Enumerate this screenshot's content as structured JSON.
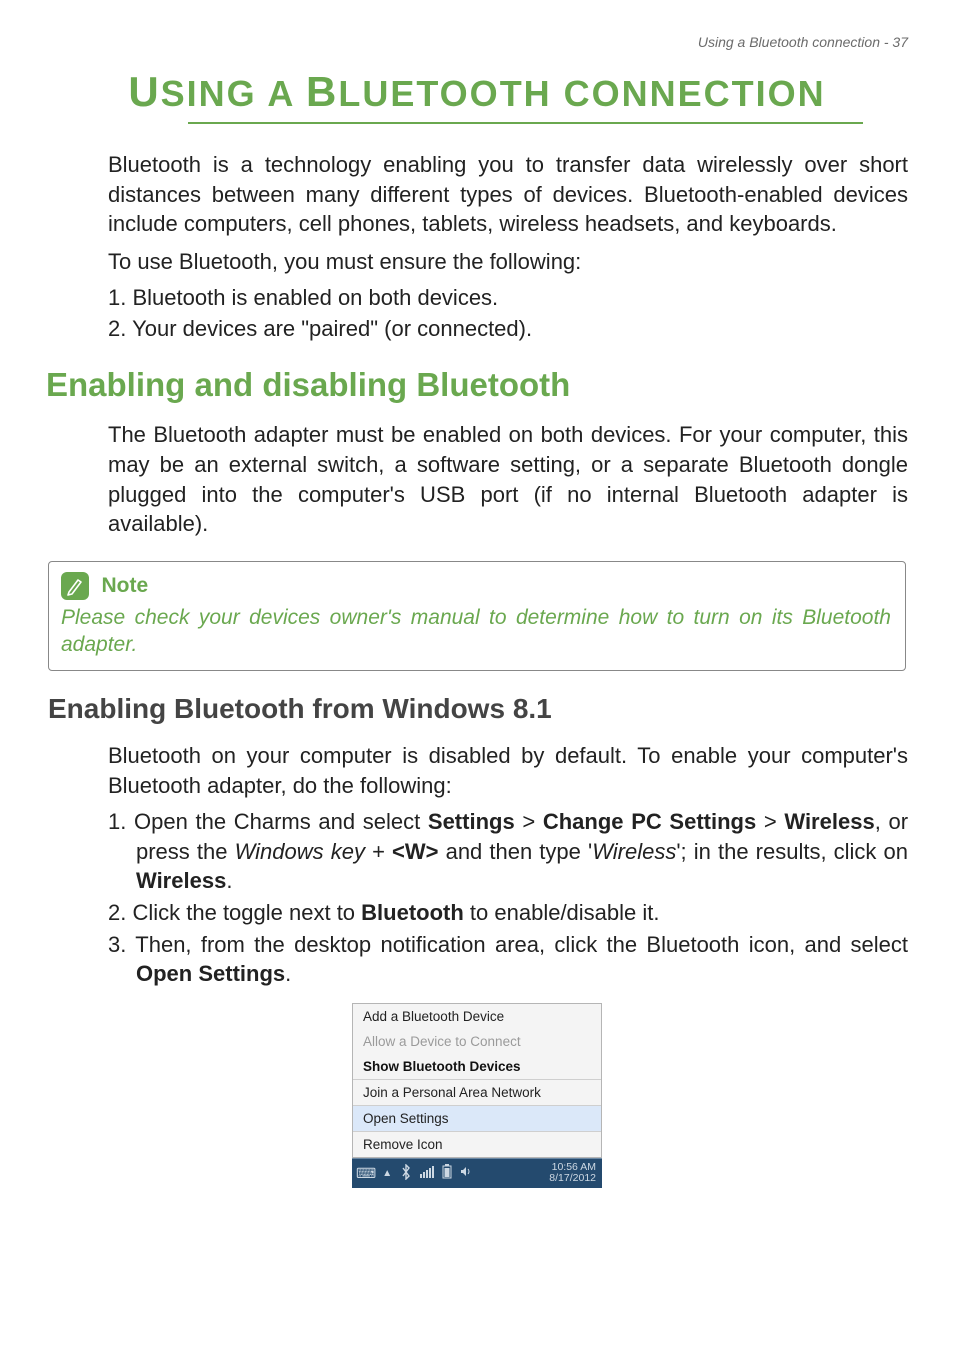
{
  "header": {
    "text": "Using a Bluetooth connection - 37"
  },
  "title": {
    "part1": "U",
    "part2": "SING A ",
    "part3": "B",
    "part4": "LUETOOTH CONNECTION"
  },
  "intro": {
    "p1": "Bluetooth is a technology enabling you to transfer data wirelessly over short distances between many different types of devices. Bluetooth-enabled devices include computers, cell phones, tablets, wireless headsets, and keyboards.",
    "p2": "To use Bluetooth, you must ensure the following:",
    "li1": "1. Bluetooth is enabled on both devices.",
    "li2": "2. Your devices are \"paired\" (or connected)."
  },
  "section1": {
    "heading": "Enabling and disabling Bluetooth",
    "body": "The Bluetooth adapter must be enabled on both devices. For your computer, this may be an external switch, a software setting, or a separate Bluetooth dongle plugged into the computer's USB port (if no internal Bluetooth adapter is available)."
  },
  "note": {
    "label": "Note",
    "text": "Please check your devices owner's manual to determine how to turn on its Bluetooth adapter."
  },
  "section2": {
    "heading": "Enabling Bluetooth from Windows 8.1",
    "p1": "Bluetooth on your computer is disabled by default. To enable your computer's Bluetooth adapter, do the following:",
    "li1": {
      "num": "1. ",
      "t1": "Open the Charms and select ",
      "b1": "Settings",
      "t2": " > ",
      "b2": "Change PC Settings",
      "t3": " > ",
      "b3": "Wireless",
      "t4": ", or press the ",
      "i1": "Windows key",
      "t5": " + ",
      "b4": "<W>",
      "t6": " and then type '",
      "i2": "Wireless",
      "t7": "'; in the results, click on ",
      "b5": "Wireless",
      "t8": "."
    },
    "li2": {
      "num": "2. ",
      "t1": "Click the toggle next to ",
      "b1": "Bluetooth",
      "t2": " to enable/disable it."
    },
    "li3": {
      "num": "3. ",
      "t1": "Then, from the desktop notification area, click the Bluetooth icon, and select ",
      "b1": "Open Settings",
      "t2": "."
    }
  },
  "bt_menu": {
    "items": {
      "add": "Add a Bluetooth Device",
      "allow": "Allow a Device to Connect",
      "show": "Show Bluetooth Devices",
      "join": "Join a Personal Area Network",
      "open": "Open Settings",
      "remove": "Remove Icon"
    },
    "clock": {
      "time": "10:56 AM",
      "date": "8/17/2012"
    }
  }
}
